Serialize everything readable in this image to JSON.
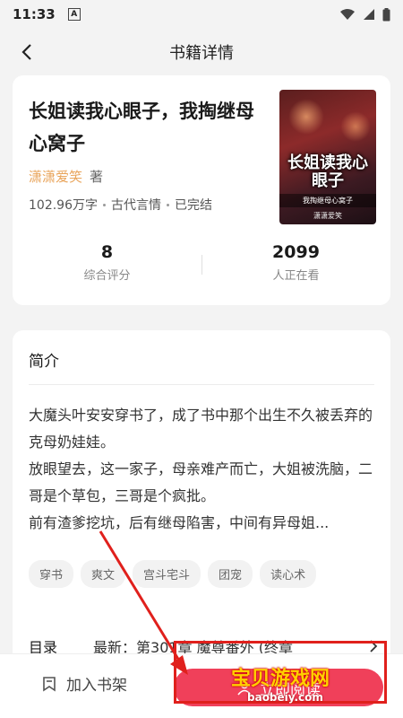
{
  "status_bar": {
    "time": "11:33",
    "notification_letter": "A"
  },
  "header": {
    "title": "书籍详情"
  },
  "book": {
    "title": "长姐读我心眼子，我掏继母心窝子",
    "author": "潇潇爱笑",
    "author_suffix": "著",
    "word_count": "102.96万字",
    "category": "古代言情",
    "status": "已完结",
    "cover": {
      "title": "长姐读我心眼子",
      "subtitle": "我掏继母心窝子",
      "author": "潇潇爱笑"
    }
  },
  "stats": [
    {
      "value": "8",
      "label": "综合评分"
    },
    {
      "value": "2099",
      "label": "人正在看"
    }
  ],
  "intro": {
    "heading": "简介",
    "paragraphs": [
      "大魔头叶安安穿书了，成了书中那个出生不久被丢弃的克母奶娃娃。",
      "放眼望去，这一家子，母亲难产而亡，大姐被洗脑，二哥是个草包，三哥是个疯批。",
      "前有渣爹挖坑，后有继母陷害，中间有异母姐..."
    ]
  },
  "tags": [
    "穿书",
    "爽文",
    "宫斗宅斗",
    "团宠",
    "读心术"
  ],
  "catalog": {
    "label": "目录",
    "latest": "最新：第301章 魔尊番外 (终章"
  },
  "bottom": {
    "shelf_label": "加入书架",
    "read_label": "立即阅读"
  },
  "watermark": {
    "main": "宝贝游戏网",
    "sub": "baobeiy.com"
  },
  "colors": {
    "accent": "#f0405a",
    "author": "#e9a55c",
    "annotation": "#e0201c"
  }
}
